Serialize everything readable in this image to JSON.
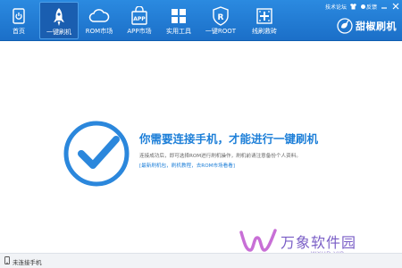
{
  "app": {
    "brand_name": "甜椒刷机"
  },
  "topbar": {
    "forum_label": "技术论坛",
    "feedback_label": "反馈"
  },
  "nav": [
    {
      "label": "首页",
      "icon": "home-icon"
    },
    {
      "label": "一键刷机",
      "icon": "rocket-icon",
      "active": true
    },
    {
      "label": "ROM市场",
      "icon": "cloud-icon"
    },
    {
      "label": "APP市场",
      "icon": "app-bag-icon"
    },
    {
      "label": "实用工具",
      "icon": "grid-icon"
    },
    {
      "label": "一键ROOT",
      "icon": "root-shield-icon"
    },
    {
      "label": "线刷救砖",
      "icon": "plus-tool-icon"
    }
  ],
  "main": {
    "title": "你需要连接手机，才能进行一键刷机",
    "description": "连接成功后，即可选择ROM进行刷机操作，刷机前请注意备份个人资料。",
    "links": "[最新刷机包，刷机教程，去ROM市场看看]"
  },
  "watermark": {
    "text": "万象软件园",
    "url": "WXHD.VIP"
  },
  "status": {
    "text": "未连接手机"
  },
  "colors": {
    "toolbar": "#1f78d1",
    "accent": "#1d7fd8",
    "watermark": "#7a5ec6"
  }
}
